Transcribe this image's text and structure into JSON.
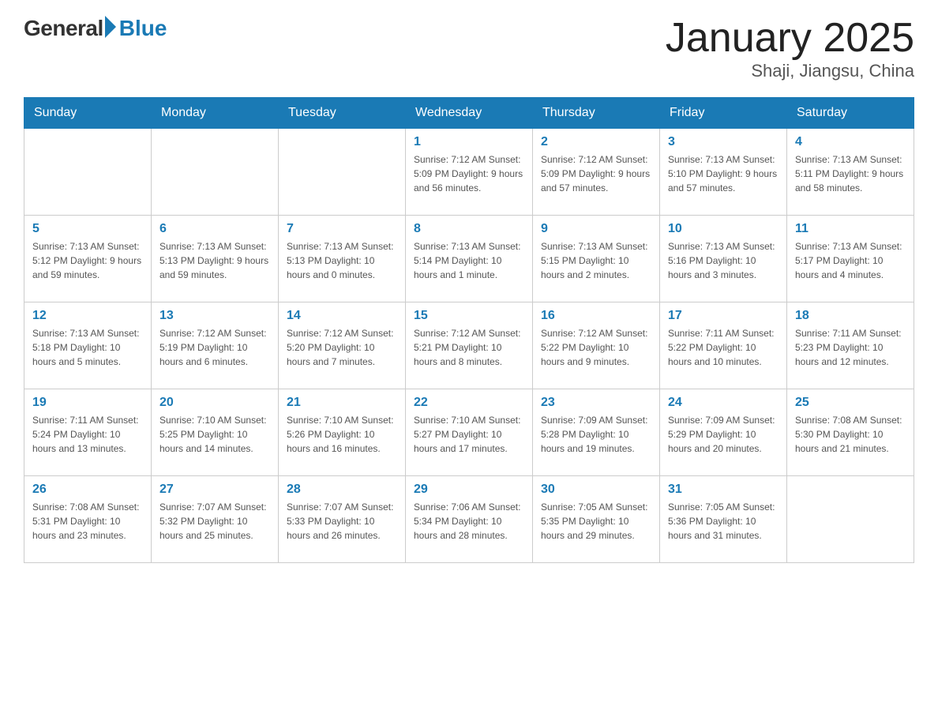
{
  "header": {
    "logo_general": "General",
    "logo_blue": "Blue",
    "month_title": "January 2025",
    "subtitle": "Shaji, Jiangsu, China"
  },
  "weekdays": [
    "Sunday",
    "Monday",
    "Tuesday",
    "Wednesday",
    "Thursday",
    "Friday",
    "Saturday"
  ],
  "weeks": [
    [
      {
        "day": "",
        "info": ""
      },
      {
        "day": "",
        "info": ""
      },
      {
        "day": "",
        "info": ""
      },
      {
        "day": "1",
        "info": "Sunrise: 7:12 AM\nSunset: 5:09 PM\nDaylight: 9 hours\nand 56 minutes."
      },
      {
        "day": "2",
        "info": "Sunrise: 7:12 AM\nSunset: 5:09 PM\nDaylight: 9 hours\nand 57 minutes."
      },
      {
        "day": "3",
        "info": "Sunrise: 7:13 AM\nSunset: 5:10 PM\nDaylight: 9 hours\nand 57 minutes."
      },
      {
        "day": "4",
        "info": "Sunrise: 7:13 AM\nSunset: 5:11 PM\nDaylight: 9 hours\nand 58 minutes."
      }
    ],
    [
      {
        "day": "5",
        "info": "Sunrise: 7:13 AM\nSunset: 5:12 PM\nDaylight: 9 hours\nand 59 minutes."
      },
      {
        "day": "6",
        "info": "Sunrise: 7:13 AM\nSunset: 5:13 PM\nDaylight: 9 hours\nand 59 minutes."
      },
      {
        "day": "7",
        "info": "Sunrise: 7:13 AM\nSunset: 5:13 PM\nDaylight: 10 hours\nand 0 minutes."
      },
      {
        "day": "8",
        "info": "Sunrise: 7:13 AM\nSunset: 5:14 PM\nDaylight: 10 hours\nand 1 minute."
      },
      {
        "day": "9",
        "info": "Sunrise: 7:13 AM\nSunset: 5:15 PM\nDaylight: 10 hours\nand 2 minutes."
      },
      {
        "day": "10",
        "info": "Sunrise: 7:13 AM\nSunset: 5:16 PM\nDaylight: 10 hours\nand 3 minutes."
      },
      {
        "day": "11",
        "info": "Sunrise: 7:13 AM\nSunset: 5:17 PM\nDaylight: 10 hours\nand 4 minutes."
      }
    ],
    [
      {
        "day": "12",
        "info": "Sunrise: 7:13 AM\nSunset: 5:18 PM\nDaylight: 10 hours\nand 5 minutes."
      },
      {
        "day": "13",
        "info": "Sunrise: 7:12 AM\nSunset: 5:19 PM\nDaylight: 10 hours\nand 6 minutes."
      },
      {
        "day": "14",
        "info": "Sunrise: 7:12 AM\nSunset: 5:20 PM\nDaylight: 10 hours\nand 7 minutes."
      },
      {
        "day": "15",
        "info": "Sunrise: 7:12 AM\nSunset: 5:21 PM\nDaylight: 10 hours\nand 8 minutes."
      },
      {
        "day": "16",
        "info": "Sunrise: 7:12 AM\nSunset: 5:22 PM\nDaylight: 10 hours\nand 9 minutes."
      },
      {
        "day": "17",
        "info": "Sunrise: 7:11 AM\nSunset: 5:22 PM\nDaylight: 10 hours\nand 10 minutes."
      },
      {
        "day": "18",
        "info": "Sunrise: 7:11 AM\nSunset: 5:23 PM\nDaylight: 10 hours\nand 12 minutes."
      }
    ],
    [
      {
        "day": "19",
        "info": "Sunrise: 7:11 AM\nSunset: 5:24 PM\nDaylight: 10 hours\nand 13 minutes."
      },
      {
        "day": "20",
        "info": "Sunrise: 7:10 AM\nSunset: 5:25 PM\nDaylight: 10 hours\nand 14 minutes."
      },
      {
        "day": "21",
        "info": "Sunrise: 7:10 AM\nSunset: 5:26 PM\nDaylight: 10 hours\nand 16 minutes."
      },
      {
        "day": "22",
        "info": "Sunrise: 7:10 AM\nSunset: 5:27 PM\nDaylight: 10 hours\nand 17 minutes."
      },
      {
        "day": "23",
        "info": "Sunrise: 7:09 AM\nSunset: 5:28 PM\nDaylight: 10 hours\nand 19 minutes."
      },
      {
        "day": "24",
        "info": "Sunrise: 7:09 AM\nSunset: 5:29 PM\nDaylight: 10 hours\nand 20 minutes."
      },
      {
        "day": "25",
        "info": "Sunrise: 7:08 AM\nSunset: 5:30 PM\nDaylight: 10 hours\nand 21 minutes."
      }
    ],
    [
      {
        "day": "26",
        "info": "Sunrise: 7:08 AM\nSunset: 5:31 PM\nDaylight: 10 hours\nand 23 minutes."
      },
      {
        "day": "27",
        "info": "Sunrise: 7:07 AM\nSunset: 5:32 PM\nDaylight: 10 hours\nand 25 minutes."
      },
      {
        "day": "28",
        "info": "Sunrise: 7:07 AM\nSunset: 5:33 PM\nDaylight: 10 hours\nand 26 minutes."
      },
      {
        "day": "29",
        "info": "Sunrise: 7:06 AM\nSunset: 5:34 PM\nDaylight: 10 hours\nand 28 minutes."
      },
      {
        "day": "30",
        "info": "Sunrise: 7:05 AM\nSunset: 5:35 PM\nDaylight: 10 hours\nand 29 minutes."
      },
      {
        "day": "31",
        "info": "Sunrise: 7:05 AM\nSunset: 5:36 PM\nDaylight: 10 hours\nand 31 minutes."
      },
      {
        "day": "",
        "info": ""
      }
    ]
  ]
}
